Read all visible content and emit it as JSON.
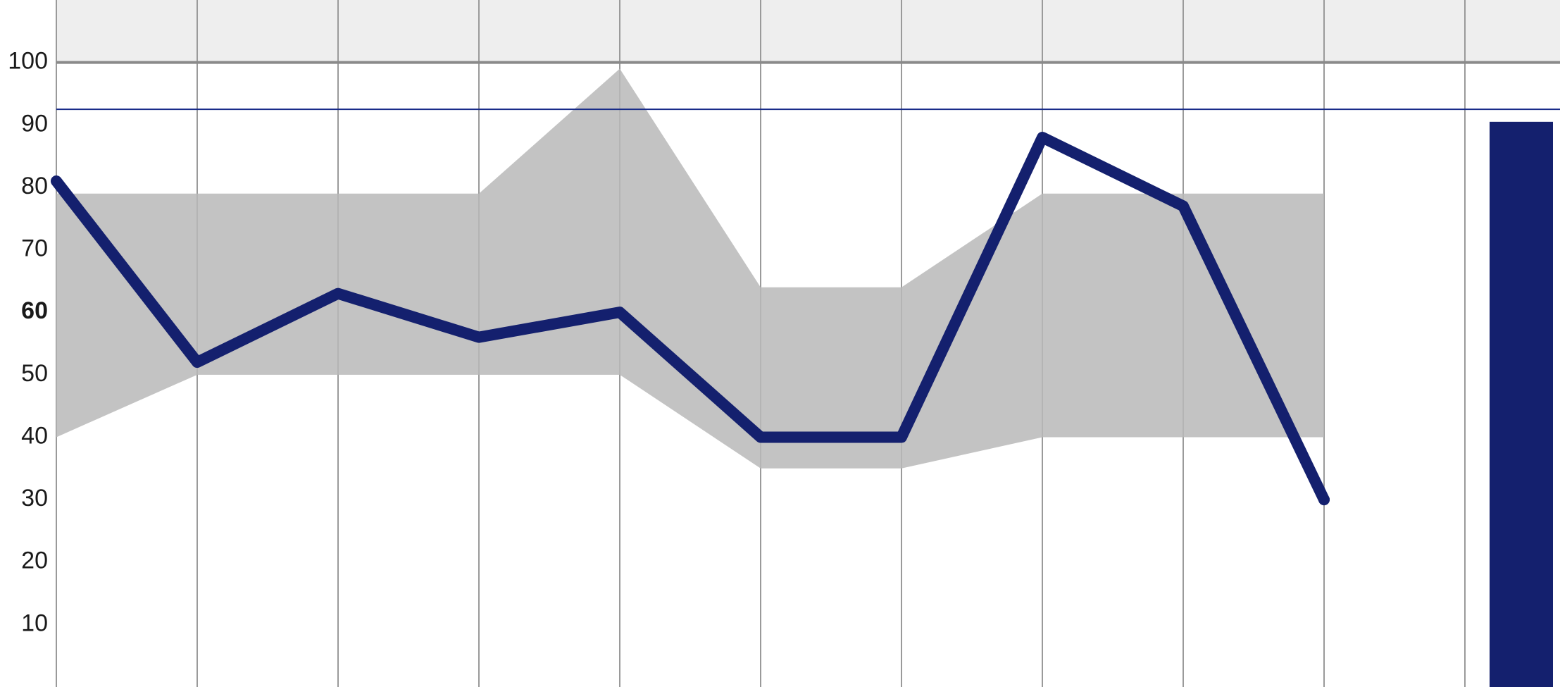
{
  "chart_data": {
    "type": "line",
    "x": [
      0,
      1,
      2,
      3,
      4,
      5,
      6,
      7,
      8,
      9
    ],
    "series": [
      {
        "name": "value-line",
        "values": [
          81,
          52,
          63,
          56,
          60,
          40,
          40,
          88,
          77,
          30
        ]
      }
    ],
    "band": {
      "name": "range-band",
      "upper": [
        79,
        79,
        79,
        79,
        99,
        64,
        64,
        79,
        79,
        79
      ],
      "lower": [
        40,
        50,
        50,
        50,
        50,
        35,
        35,
        40,
        40,
        40
      ]
    },
    "reference_lines": [
      {
        "name": "ref-100",
        "value": 100,
        "color": "#8a8a8a"
      },
      {
        "name": "ref-92",
        "value": 92.5,
        "color": "#162a88"
      }
    ],
    "bar": {
      "name": "end-bar",
      "value": 90.5
    },
    "yticks": [
      10,
      20,
      30,
      40,
      50,
      60,
      70,
      80,
      90,
      100
    ],
    "ytick_bold": 60,
    "ylim": [
      0,
      110
    ],
    "xlabel": "",
    "ylabel": "",
    "title": "",
    "colors": {
      "line": "#14206e",
      "band": "#b9b9b9",
      "bar": "#14206e",
      "grid": "#9a9a9a",
      "above100_bg": "#eeeeee",
      "ref100": "#8a8a8a",
      "ref92": "#162a88"
    }
  },
  "yticks": {
    "t10": "10",
    "t20": "20",
    "t30": "30",
    "t40": "40",
    "t50": "50",
    "t60": "60",
    "t70": "70",
    "t80": "80",
    "t90": "90",
    "t100": "100"
  }
}
